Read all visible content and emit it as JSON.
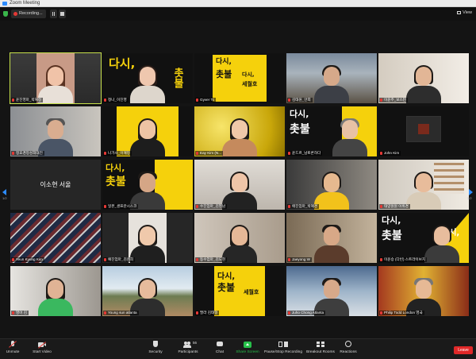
{
  "window": {
    "title": "Zoom Meeting"
  },
  "topbar": {
    "recording_label": "Recording...",
    "view_label": "View"
  },
  "navigation": {
    "left_page": "1/2",
    "right_page": "1/2"
  },
  "banner_text": {
    "line1": "다시,",
    "line2": "촛불",
    "line3": "세월호",
    "vertical": "촛불"
  },
  "participants": [
    {
      "name": "윤진영마_박혜정"
    },
    {
      "name": "정나_이진영"
    },
    {
      "name": "Gyver Tc"
    },
    {
      "name": "김태원_안희"
    },
    {
      "name": "이윤주_보스턴"
    },
    {
      "name": "정효경정성희대진"
    },
    {
      "name": "나가사_이혜정"
    },
    {
      "name": "Eay Kim (N..."
    },
    {
      "name": "윤드르_남토론하다"
    },
    {
      "name": "John Kim"
    },
    {
      "name": "이소현 서울"
    },
    {
      "name": "일본_샌프란시스코"
    },
    {
      "name": "수진엄마_김영남"
    },
    {
      "name": "애진엄마_박혜경"
    },
    {
      "name": "태양원원 이위경"
    },
    {
      "name": "Yeun Kyung Kim"
    },
    {
      "name": "예진엄마_김은희"
    },
    {
      "name": "동수엄마_김도현"
    },
    {
      "name": "Jaeyong W"
    },
    {
      "name": "이윤승 (다빈) 스트라이브치"
    },
    {
      "name": "영어 김"
    },
    {
      "name": "Young sun atlanta"
    },
    {
      "name": "팔라 김태형"
    },
    {
      "name": "Juho Chong Atlanta"
    },
    {
      "name": "Philip Todd London 영국"
    }
  ],
  "toolbar": {
    "unmute": "Unmute",
    "start_video": "Start Video",
    "security": "Security",
    "participants": "Participants",
    "participants_count": "56",
    "chat": "Chat",
    "share_screen": "Share Screen",
    "pause_recording": "Pause/Stop Recording",
    "breakout_rooms": "Breakout Rooms",
    "reactions": "Reactions",
    "leave": "Leave"
  },
  "colors": {
    "accent_yellow": "#f5d10c",
    "active_speaker": "#c6e04b",
    "leave_red": "#e02828",
    "share_green": "#27c04a"
  }
}
